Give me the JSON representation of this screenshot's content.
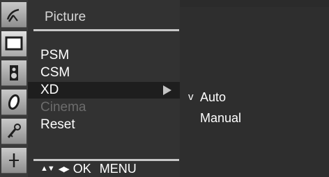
{
  "menu": {
    "title": "Picture",
    "items": [
      {
        "label": "PSM",
        "state": "normal"
      },
      {
        "label": "CSM",
        "state": "normal"
      },
      {
        "label": "XD",
        "state": "selected"
      },
      {
        "label": "Cinema",
        "state": "disabled"
      },
      {
        "label": "Reset",
        "state": "normal"
      }
    ]
  },
  "navigation": {
    "up_down_glyph": "▲▼",
    "left_right_glyph": "◀▶",
    "ok_label": "OK",
    "menu_label": "MENU"
  },
  "submenu": {
    "items": [
      {
        "label": "Auto",
        "check": "v",
        "checked": true
      },
      {
        "label": "Manual",
        "check": "",
        "checked": false
      }
    ]
  },
  "icons": [
    {
      "name": "satellite-dish-icon",
      "active": false
    },
    {
      "name": "picture-screen-icon",
      "active": true
    },
    {
      "name": "speaker-icon",
      "active": false
    },
    {
      "name": "clock-icon",
      "active": false
    },
    {
      "name": "key-icon",
      "active": false
    },
    {
      "name": "input-source-icon",
      "active": false
    }
  ],
  "colors": {
    "background": "#2b2b2b",
    "menu_panel": "#323232",
    "selected_row": "#1e1e1e",
    "disabled_text": "#6c6c6c",
    "text": "#ffffff"
  }
}
